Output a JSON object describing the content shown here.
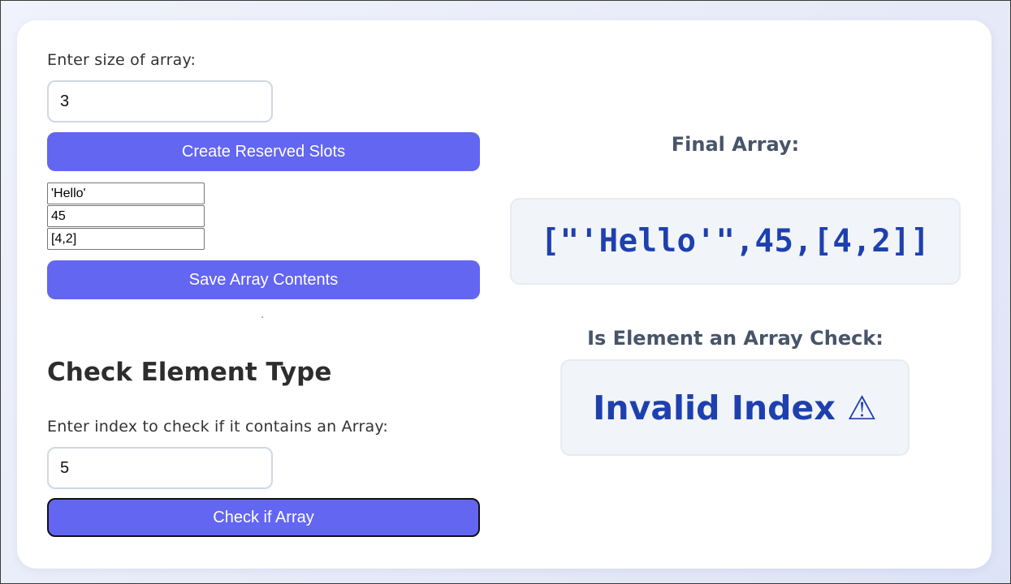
{
  "size_section": {
    "label": "Enter size of array:",
    "value": "3",
    "create_button": "Create Reserved Slots"
  },
  "slots": [
    "'Hello'",
    "45",
    "[4,2]"
  ],
  "save_button": "Save Array Contents",
  "check_section": {
    "heading": "Check Element Type",
    "label": "Enter index to check if it contains an Array:",
    "value": "5",
    "check_button": "Check if Array"
  },
  "result": {
    "final_array_title": "Final Array:",
    "final_array_value": "[\"'Hello'\",45,[4,2]]",
    "check_title": "Is Element an Array Check:",
    "check_value": "Invalid Index ⚠"
  },
  "colors": {
    "button": "#6366f1",
    "result_text": "#1e40af",
    "panel_bg": "#f1f4f9"
  }
}
